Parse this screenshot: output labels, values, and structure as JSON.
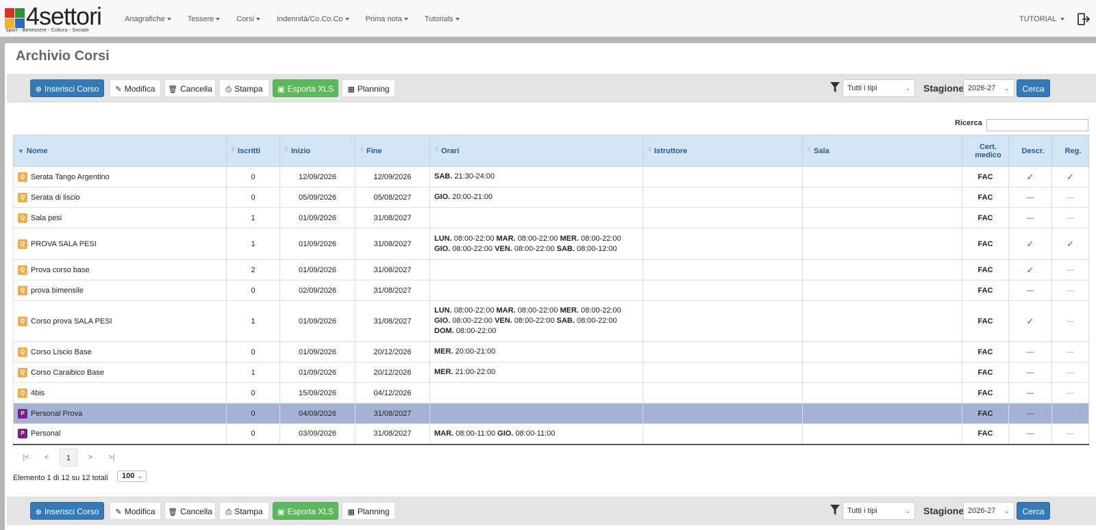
{
  "brand": {
    "name": "4settori",
    "tagline": "Sport - Benessere - Cultura - Sociale",
    "square_colors": [
      "#d9302c",
      "#2f8f3a",
      "#f0b323",
      "#2a6db3"
    ]
  },
  "nav": {
    "items": [
      {
        "label": "Anagrafiche"
      },
      {
        "label": "Tessere"
      },
      {
        "label": "Corsi"
      },
      {
        "label": "Indennità/Co.Co.Co"
      },
      {
        "label": "Prima nota"
      },
      {
        "label": "Tutorials"
      }
    ],
    "user": "TUTORIAL",
    "logout_icon": "logout-icon"
  },
  "page": {
    "title": "Archivio Corsi"
  },
  "toolbar": {
    "insert_label": "Inserisci Corso",
    "edit_label": "Modifica",
    "delete_label": "Cancella",
    "print_label": "Stampa",
    "export_label": "Esporta XLS",
    "planning_label": "Planning",
    "type_filter_value": "Tutti i tipi",
    "season_label": "Stagione",
    "season_value": "2026-27",
    "search_label": "Cerca",
    "colors": {
      "primary": "#337ab7",
      "success": "#5cb85c"
    }
  },
  "search": {
    "label": "Ricerca",
    "value": ""
  },
  "table": {
    "columns": {
      "nome": "Nome",
      "iscritti": "Iscritti",
      "inizio": "Inizio",
      "fine": "Fine",
      "orari": "Orari",
      "istruttore": "Istruttore",
      "sala": "Sala",
      "cert_line1": "Cert.",
      "cert_line2": "medico",
      "descr": "Descr.",
      "reg": "Reg."
    },
    "rows": [
      {
        "badge": "Q",
        "nome": "Serata Tango Argentino",
        "iscritti": "0",
        "inizio": "12/09/2026",
        "fine": "12/09/2026",
        "orari": [
          [
            "SAB.",
            "21:30-24:00"
          ]
        ],
        "istruttore": "",
        "sala": "",
        "cert": "FAC",
        "descr": "✓",
        "reg": "✓"
      },
      {
        "badge": "Q",
        "nome": "Serata di liscio",
        "iscritti": "0",
        "inizio": "05/09/2026",
        "fine": "05/08/2027",
        "orari": [
          [
            "GIO.",
            "20:00-21:00"
          ]
        ],
        "istruttore": "",
        "sala": "",
        "cert": "FAC",
        "descr": "—",
        "reg": "—"
      },
      {
        "badge": "Q",
        "nome": "Sala pesi",
        "iscritti": "1",
        "inizio": "01/09/2026",
        "fine": "31/08/2027",
        "orari": [],
        "istruttore": "",
        "sala": "",
        "cert": "FAC",
        "descr": "—",
        "reg": "—"
      },
      {
        "badge": "Q",
        "nome": "PROVA SALA PESI",
        "iscritti": "1",
        "inizio": "01/09/2026",
        "fine": "31/08/2027",
        "orari": [
          [
            "LUN.",
            "08:00-22:00"
          ],
          [
            "MAR.",
            "08:00-22:00"
          ],
          [
            "MER.",
            "08:00-22:00"
          ],
          [
            "GIO.",
            "08:00-22:00"
          ],
          [
            "VEN.",
            "08:00-22:00"
          ],
          [
            "SAB.",
            "08:00-12:00"
          ]
        ],
        "istruttore": "",
        "sala": "",
        "cert": "FAC",
        "descr": "✓",
        "reg": "✓"
      },
      {
        "badge": "Q",
        "nome": "Prova corso base",
        "iscritti": "2",
        "inizio": "01/09/2026",
        "fine": "31/08/2027",
        "orari": [],
        "istruttore": "",
        "sala": "",
        "cert": "FAC",
        "descr": "✓",
        "reg": "—"
      },
      {
        "badge": "Q",
        "nome": "prova bimensile",
        "iscritti": "0",
        "inizio": "02/09/2026",
        "fine": "31/08/2027",
        "orari": [],
        "istruttore": "",
        "sala": "",
        "cert": "FAC",
        "descr": "—",
        "reg": "—"
      },
      {
        "badge": "Q",
        "nome": "Corso prova SALA PESI",
        "iscritti": "1",
        "inizio": "01/09/2026",
        "fine": "31/08/2027",
        "orari": [
          [
            "LUN.",
            "08:00-22:00"
          ],
          [
            "MAR.",
            "08:00-22:00"
          ],
          [
            "MER.",
            "08:00-22:00"
          ],
          [
            "GIO.",
            "08:00-22:00"
          ],
          [
            "VEN.",
            "08:00-22:00"
          ],
          [
            "SAB.",
            "08:00-22:00"
          ],
          [
            "DOM.",
            "08:00-22:00"
          ]
        ],
        "istruttore": "",
        "sala": "",
        "cert": "FAC",
        "descr": "✓",
        "reg": "—"
      },
      {
        "badge": "Q",
        "nome": "Corso Liscio Base",
        "iscritti": "0",
        "inizio": "01/09/2026",
        "fine": "20/12/2026",
        "orari": [
          [
            "MER.",
            "20:00-21:00"
          ]
        ],
        "istruttore": "",
        "sala": "",
        "cert": "FAC",
        "descr": "—",
        "reg": "—"
      },
      {
        "badge": "Q",
        "nome": "Corso Caraibico Base",
        "iscritti": "1",
        "inizio": "01/09/2026",
        "fine": "20/12/2026",
        "orari": [
          [
            "MER.",
            "21:00-22:00"
          ]
        ],
        "istruttore": "",
        "sala": "",
        "cert": "FAC",
        "descr": "—",
        "reg": "—"
      },
      {
        "badge": "Q",
        "nome": "4bis",
        "iscritti": "0",
        "inizio": "15/09/2026",
        "fine": "04/12/2026",
        "orari": [],
        "istruttore": "",
        "sala": "",
        "cert": "FAC",
        "descr": "—",
        "reg": "—"
      },
      {
        "badge": "P",
        "nome": "Personal Prova",
        "iscritti": "0",
        "inizio": "04/09/2026",
        "fine": "31/08/2027",
        "orari": [],
        "istruttore": "",
        "sala": "",
        "cert": "FAC",
        "descr": "—",
        "reg": "—",
        "selected": true
      },
      {
        "badge": "P",
        "nome": "Personal",
        "iscritti": "0",
        "inizio": "03/09/2026",
        "fine": "31/08/2027",
        "orari": [
          [
            "MAR.",
            "08:00-11:00"
          ],
          [
            "GIO.",
            "08:00-11:00"
          ]
        ],
        "istruttore": "",
        "sala": "",
        "cert": "FAC",
        "descr": "—",
        "reg": "—"
      }
    ]
  },
  "pagination": {
    "first": "|<",
    "prev": "<",
    "current": "1",
    "next": ">",
    "last": ">|",
    "info": "Elemento 1 di 12 su 12 totali",
    "page_size": "100"
  }
}
